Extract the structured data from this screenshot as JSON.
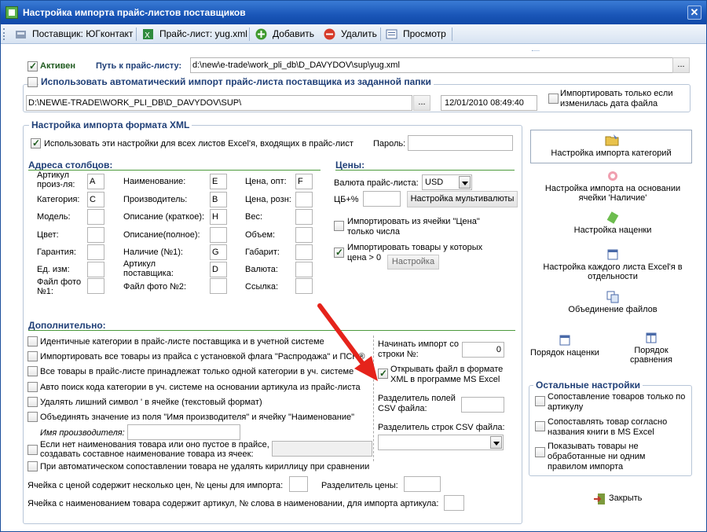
{
  "window": {
    "title": "Настройка импорта прайс-листов поставщиков",
    "close": "✕"
  },
  "toolbar": {
    "supplier": "Поставщик: ЮГконтакт",
    "pricelist": "Прайс-лист: yug.xml",
    "add": "Добавить",
    "delete": "Удалить",
    "preview": "Просмотр"
  },
  "top": {
    "active_label": "Активен",
    "path_label": "Путь к прайс-листу:",
    "path_value": "d:\\new\\e-trade\\work_pli_db\\D_DAVYDOV\\sup\\yug.xml",
    "browse": "...",
    "auto_import_label": "Использовать автоматический импорт прайс-листа поставщика из заданной папки",
    "folder_value": "D:\\NEW\\E-TRADE\\WORK_PLI_DB\\D_DAVYDOV\\SUP\\",
    "folder_browse": "...",
    "date_value": "12/01/2010 08:49:40",
    "import_if_changed": "Импортировать только если изменилась дата файла"
  },
  "xml": {
    "group_title": "Настройка импорта формата XML",
    "use_for_all": "Использовать эти настройки для всех листов Excel'я, входящих в прайс-лист",
    "password_label": "Пароль:",
    "password_value": ""
  },
  "columns": {
    "title": "Адреса столбцов:",
    "col1": [
      {
        "label": "Артикул произ-ля:",
        "value": "A"
      },
      {
        "label": "Категория:",
        "value": "C"
      },
      {
        "label": "Модель:",
        "value": ""
      },
      {
        "label": "Цвет:",
        "value": ""
      },
      {
        "label": "Гарантия:",
        "value": ""
      },
      {
        "label": "Ед. изм:",
        "value": ""
      },
      {
        "label": "Файл фото №1:",
        "value": ""
      }
    ],
    "col2": [
      {
        "label": "Наименование:",
        "value": "E"
      },
      {
        "label": "Производитель:",
        "value": "B"
      },
      {
        "label": "Описание (краткое):",
        "value": "H"
      },
      {
        "label": "Описание(полное):",
        "value": ""
      },
      {
        "label": "Наличие (№1):",
        "value": "G"
      },
      {
        "label": "Артикул поставщика:",
        "value": "D"
      },
      {
        "label": "Файл фото №2:",
        "value": ""
      }
    ],
    "col3": [
      {
        "label": "Цена, опт:",
        "value": "F"
      },
      {
        "label": "Цена, розн:",
        "value": ""
      },
      {
        "label": "Вес:",
        "value": ""
      },
      {
        "label": "Объем:",
        "value": ""
      },
      {
        "label": "Габарит:",
        "value": ""
      },
      {
        "label": "Валюта:",
        "value": ""
      },
      {
        "label": "Ссылка:",
        "value": ""
      }
    ]
  },
  "prices": {
    "title": "Цены:",
    "currency_label": "Валюта прайс-листа:",
    "currency_value": "USD",
    "cb_label": "ЦБ+%",
    "cb_value": "",
    "multipliers_btn": "Настройка мультивалюты",
    "import_price_numbers": "Импортировать из ячейки \"Цена\" только числа",
    "import_goods_price": "Импортировать товары у которых цена > 0",
    "settings_btn": "Настройка"
  },
  "extra": {
    "title": "Дополнительно:",
    "items": [
      "Идентичные категории в прайс-листе поставщика и в учетной системе",
      "Импортировать все товары из прайса с установкой флага \"Распродажа\" и ПСН®",
      "Все товары в прайс-листе принадлежат только одной категории в уч. системе",
      "Авто поиск кода категории в уч. системе на основании артикула из прайс-листа",
      "Удалять лишний символ ' в ячейке (текстовый формат)",
      "Объединять значение из поля \"Имя производителя\" и ячейку \"Наименование\""
    ],
    "manufacturer_name_label": "Имя производителя:",
    "manufacturer_name_value": "",
    "no_name_label": "Если нет наименования товара или оно пустое в прайсе, создавать составное наименование товара из ячеек:",
    "no_name_value": "",
    "keep_cyrillic": "При автоматическом сопоставлении товара не удалять кириллицу при сравнении",
    "multi_price_label": "Ячейка с ценой содержит несколько цен, № цены для импорта:",
    "multi_price_value": "",
    "price_sep_label": "Разделитель цены:",
    "price_sep_value": "",
    "article_in_name_label": "Ячейка с наименованием товара содержит артикул, № слова в наименовании, для импорта артикула:",
    "article_in_name_value": "",
    "start_row_label": "Начинать импорт со строки №:",
    "start_row_value": "0",
    "open_in_excel": "Открывать файл в формате XML в программе MS Excel",
    "csv_field_sep_label": "Разделитель полей CSV файла:",
    "csv_field_sep_value": "",
    "csv_row_sep_label": "Разделитель строк CSV файла:",
    "csv_row_sep_value": ""
  },
  "right": {
    "category_import": "Настройка импорта категорий",
    "availability_import": "Настройка импорта на основании ячейки 'Наличие'",
    "markup": "Настройка наценки",
    "each_sheet": "Настройка каждого листа Excel'я в отдельности",
    "merge_files": "Объединение файлов",
    "markup_order": "Порядок наценки",
    "compare_order": "Порядок сравнения",
    "other_title": "Остальные настройки",
    "other_items": [
      "Сопоставление товаров только по артикулу",
      "Сопоставлять товар согласно названия книги в MS Excel",
      "Показывать товары не обработанные ни одним правилом импорта"
    ],
    "close": "Закрыть"
  }
}
